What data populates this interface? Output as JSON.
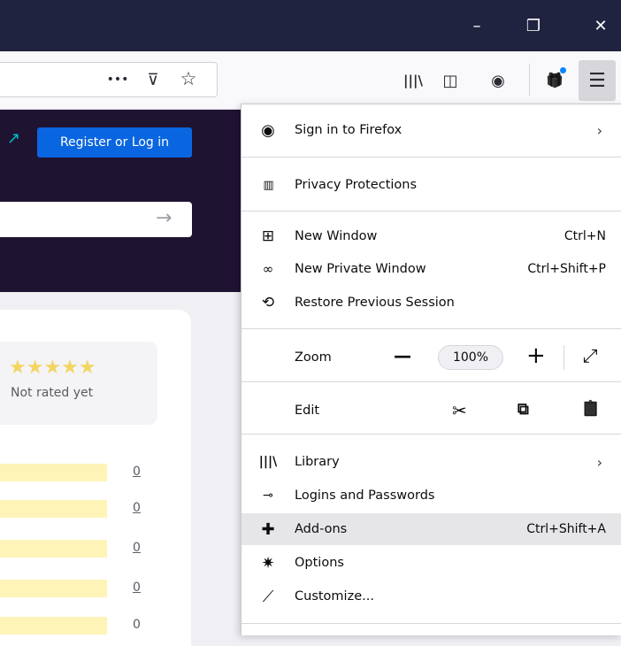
{
  "titlebar": {
    "minimize": "–",
    "restore": "❐",
    "close": "✕"
  },
  "toolbar": {
    "more": "•••",
    "pocket": "⊽",
    "bookmark": "☆",
    "library": "|||\\",
    "sidebar": "◫",
    "account": "◉",
    "whatsnew": "🎁",
    "menu": "☰"
  },
  "page": {
    "register_label": "Register or Log in",
    "ext_glyph": "↗",
    "search_arrow": "→",
    "stars": "★★★★★",
    "not_rated": "Not rated yet",
    "counts": [
      "0",
      "0",
      "0",
      "0",
      "0"
    ]
  },
  "menu": {
    "sign_in": "Sign in to Firefox",
    "privacy": "Privacy Protections",
    "new_window": "New Window",
    "new_window_sc": "Ctrl+N",
    "private_window": "New Private Window",
    "private_window_sc": "Ctrl+Shift+P",
    "restore_session": "Restore Previous Session",
    "zoom": "Zoom",
    "zoom_minus": "—",
    "zoom_value": "100%",
    "zoom_plus": "+",
    "fullscreen": "⤢",
    "edit": "Edit",
    "cut": "✂",
    "copy": "⧉",
    "paste": "📋",
    "library": "Library",
    "logins": "Logins and Passwords",
    "addons": "Add-ons",
    "addons_sc": "Ctrl+Shift+A",
    "options": "Options",
    "customize": "Customize...",
    "chevron": "›"
  }
}
